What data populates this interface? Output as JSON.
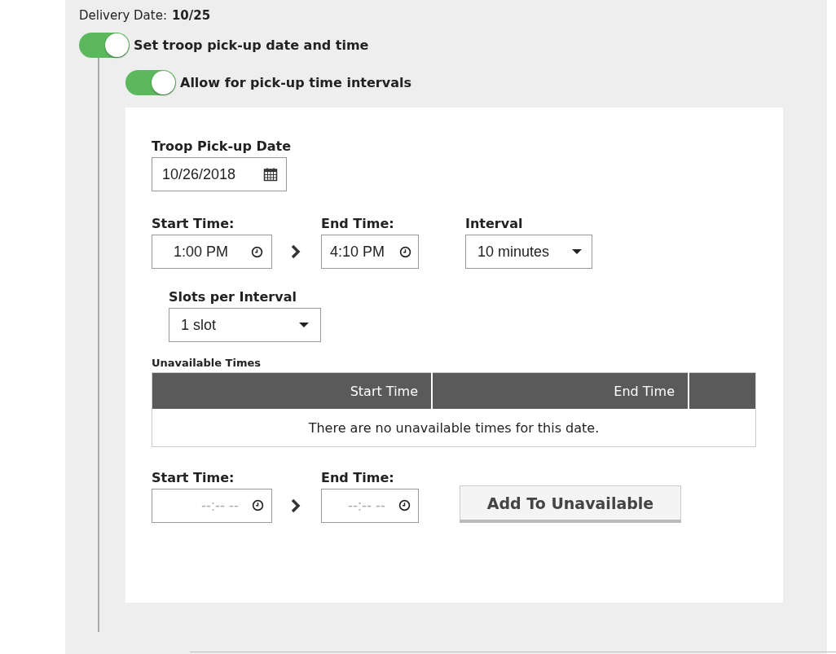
{
  "delivery": {
    "label": "Delivery Date:",
    "value": "10/25"
  },
  "toggles": [
    {
      "label": "Set troop pick-up date and time",
      "on": true
    },
    {
      "label": "Allow for pick-up time intervals",
      "on": true
    }
  ],
  "pickup_date": {
    "label": "Troop Pick-up Date",
    "value": "10/26/2018"
  },
  "time_range": {
    "start": {
      "label": "Start Time:",
      "value": "1:00 PM"
    },
    "end": {
      "label": "End Time:",
      "value": "4:10 PM"
    }
  },
  "interval": {
    "label": "Interval",
    "value": "10 minutes"
  },
  "slots": {
    "label": "Slots per Interval",
    "value": "1 slot"
  },
  "unavailable": {
    "title": "Unavailable Times",
    "columns": [
      "Start Time",
      "End Time"
    ],
    "empty_message": "There are no unavailable times for this date."
  },
  "new_unavailable": {
    "start": {
      "label": "Start Time:",
      "placeholder": "--:-- --"
    },
    "end": {
      "label": "End Time:",
      "placeholder": "--:-- --"
    },
    "button": "Add To Unavailable"
  }
}
